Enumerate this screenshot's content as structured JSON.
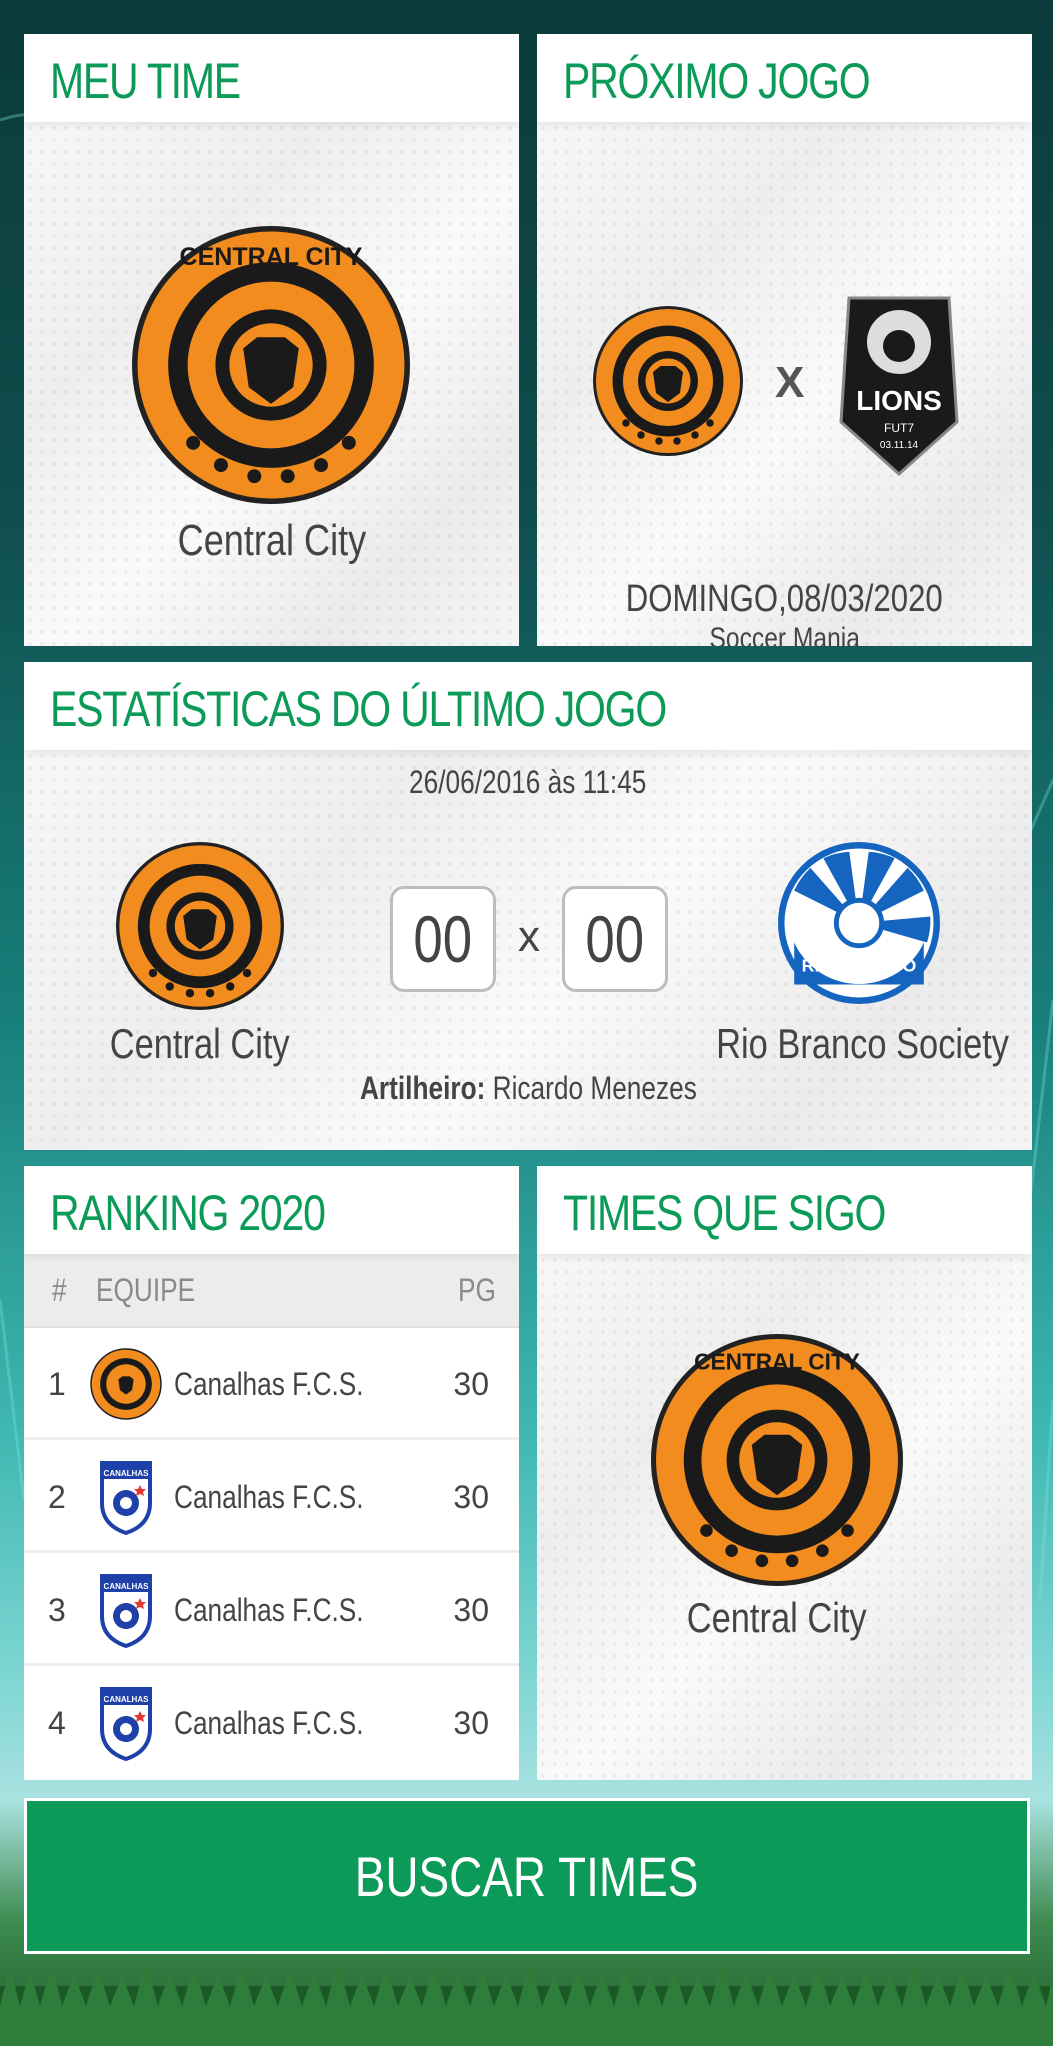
{
  "colors": {
    "accent": "#0b9a57",
    "text": "#444444",
    "crest_orange": "#f28c1e"
  },
  "meu_time": {
    "title": "MEU TIME",
    "team_name": "Central City",
    "logo_icon": "central-city-crest-icon",
    "logo_text": "CENTRAL CITY"
  },
  "proximo_jogo": {
    "title": "PRÓXIMO JOGO",
    "home_logo_icon": "central-city-crest-icon",
    "vs": "X",
    "away_logo_icon": "lions-fut7-crest-icon",
    "away_logo_text": "LIONS",
    "away_logo_sub": "FUT7",
    "away_logo_date": "03.11.14",
    "date": "DOMINGO,08/03/2020",
    "venue": "Soccer Mania"
  },
  "estatisticas": {
    "title": "ESTATÍSTICAS DO ÚLTIMO JOGO",
    "datetime": "26/06/2016 às 11:45",
    "home_team": "Central City",
    "away_team": "Rio Branco Society",
    "away_logo_text": "RIO BRANCO",
    "home_score": "00",
    "away_score": "00",
    "vs": "x",
    "scorer_label": "Artilheiro:",
    "scorer_name": "Ricardo Menezes"
  },
  "ranking": {
    "title": "RANKING 2020",
    "columns": {
      "pos": "#",
      "team": "EQUIPE",
      "points": "PG"
    },
    "rows": [
      {
        "pos": "1",
        "team": "Canalhas F.C.S.",
        "points": "30",
        "badge_icon": "central-city-crest-icon"
      },
      {
        "pos": "2",
        "team": "Canalhas F.C.S.",
        "points": "30",
        "badge_icon": "canalhas-shield-icon"
      },
      {
        "pos": "3",
        "team": "Canalhas F.C.S.",
        "points": "30",
        "badge_icon": "canalhas-shield-icon"
      },
      {
        "pos": "4",
        "team": "Canalhas F.C.S.",
        "points": "30",
        "badge_icon": "canalhas-shield-icon"
      }
    ],
    "shield_text": "CANALHAS"
  },
  "times_que_sigo": {
    "title": "TIMES QUE SIGO",
    "team_name": "Central City"
  },
  "buscar": {
    "label": "BUSCAR TIMES"
  }
}
